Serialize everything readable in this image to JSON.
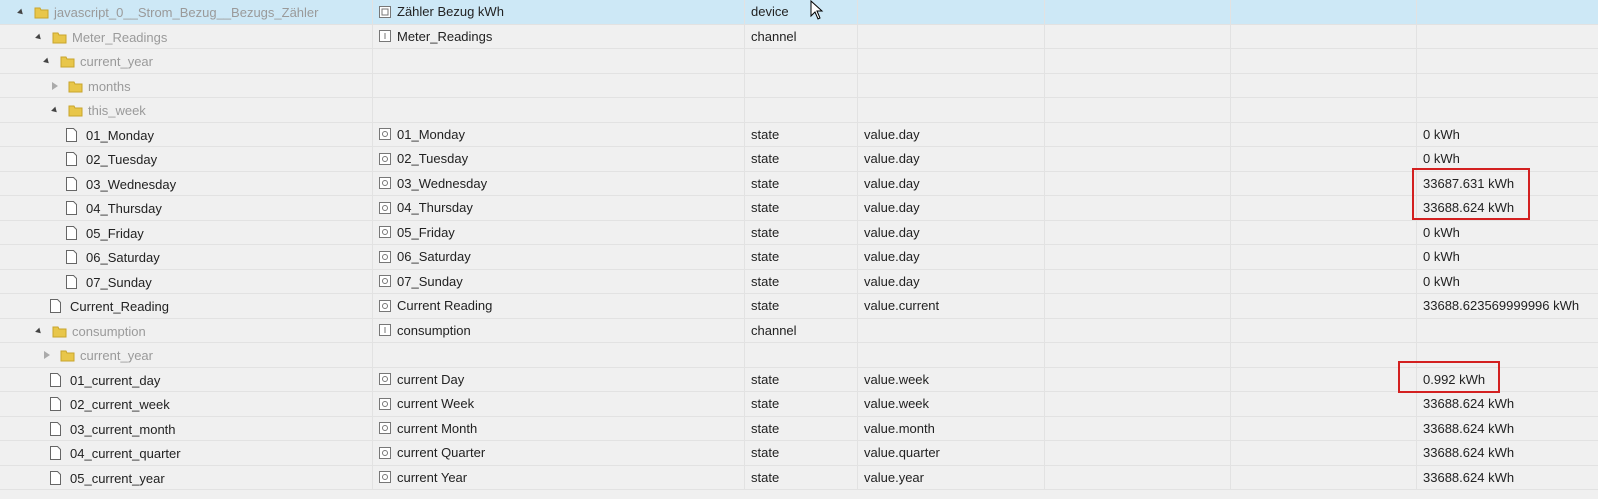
{
  "colors": {
    "selected_row": "#cde8f6",
    "highlight_border": "#d32020",
    "folder": "#e8c64a"
  },
  "rows": [
    {
      "id": "javascript_0__Strom_Bezug__Bezugs_Zähler",
      "name": "Zähler Bezug kWh",
      "type": "device",
      "role": "",
      "value": "",
      "kind": "folder",
      "toggle": "open",
      "name_icon": "device-icon"
    },
    {
      "id": "Meter_Readings",
      "name": "Meter_Readings",
      "type": "channel",
      "role": "",
      "value": "",
      "kind": "folder",
      "toggle": "open",
      "name_icon": "channel-icon"
    },
    {
      "id": "current_year",
      "name": "",
      "type": "",
      "role": "",
      "value": "",
      "kind": "folder",
      "toggle": "open",
      "name_icon": ""
    },
    {
      "id": "months",
      "name": "",
      "type": "",
      "role": "",
      "value": "",
      "kind": "folder",
      "toggle": "closed",
      "name_icon": ""
    },
    {
      "id": "this_week",
      "name": "",
      "type": "",
      "role": "",
      "value": "",
      "kind": "folder",
      "toggle": "open",
      "name_icon": ""
    },
    {
      "id": "01_Monday",
      "name": "01_Monday",
      "type": "state",
      "role": "value.day",
      "value": "0 kWh",
      "kind": "state",
      "toggle": "",
      "name_icon": "state-icon"
    },
    {
      "id": "02_Tuesday",
      "name": "02_Tuesday",
      "type": "state",
      "role": "value.day",
      "value": "0 kWh",
      "kind": "state",
      "toggle": "",
      "name_icon": "state-icon"
    },
    {
      "id": "03_Wednesday",
      "name": "03_Wednesday",
      "type": "state",
      "role": "value.day",
      "value": "33687.631 kWh",
      "kind": "state",
      "toggle": "",
      "name_icon": "state-icon"
    },
    {
      "id": "04_Thursday",
      "name": "04_Thursday",
      "type": "state",
      "role": "value.day",
      "value": "33688.624 kWh",
      "kind": "state",
      "toggle": "",
      "name_icon": "state-icon"
    },
    {
      "id": "05_Friday",
      "name": "05_Friday",
      "type": "state",
      "role": "value.day",
      "value": "0 kWh",
      "kind": "state",
      "toggle": "",
      "name_icon": "state-icon"
    },
    {
      "id": "06_Saturday",
      "name": "06_Saturday",
      "type": "state",
      "role": "value.day",
      "value": "0 kWh",
      "kind": "state",
      "toggle": "",
      "name_icon": "state-icon"
    },
    {
      "id": "07_Sunday",
      "name": "07_Sunday",
      "type": "state",
      "role": "value.day",
      "value": "0 kWh",
      "kind": "state",
      "toggle": "",
      "name_icon": "state-icon"
    },
    {
      "id": "Current_Reading",
      "name": "Current Reading",
      "type": "state",
      "role": "value.current",
      "value": "33688.623569999996 kWh",
      "kind": "state",
      "toggle": "",
      "name_icon": "state-icon"
    },
    {
      "id": "consumption",
      "name": "consumption",
      "type": "channel",
      "role": "",
      "value": "",
      "kind": "folder",
      "toggle": "open",
      "name_icon": "channel-icon"
    },
    {
      "id": "current_year",
      "name": "",
      "type": "",
      "role": "",
      "value": "",
      "kind": "folder",
      "toggle": "closed",
      "name_icon": ""
    },
    {
      "id": "01_current_day",
      "name": "current Day",
      "type": "state",
      "role": "value.week",
      "value": "0.992 kWh",
      "kind": "state",
      "toggle": "",
      "name_icon": "state-icon"
    },
    {
      "id": "02_current_week",
      "name": "current Week",
      "type": "state",
      "role": "value.week",
      "value": "33688.624 kWh",
      "kind": "state",
      "toggle": "",
      "name_icon": "state-icon"
    },
    {
      "id": "03_current_month",
      "name": "current Month",
      "type": "state",
      "role": "value.month",
      "value": "33688.624 kWh",
      "kind": "state",
      "toggle": "",
      "name_icon": "state-icon"
    },
    {
      "id": "04_current_quarter",
      "name": "current Quarter",
      "type": "state",
      "role": "value.quarter",
      "value": "33688.624 kWh",
      "kind": "state",
      "toggle": "",
      "name_icon": "state-icon"
    },
    {
      "id": "05_current_year",
      "name": "current Year",
      "type": "state",
      "role": "value.year",
      "value": "33688.624 kWh",
      "kind": "state",
      "toggle": "",
      "name_icon": "state-icon"
    }
  ]
}
